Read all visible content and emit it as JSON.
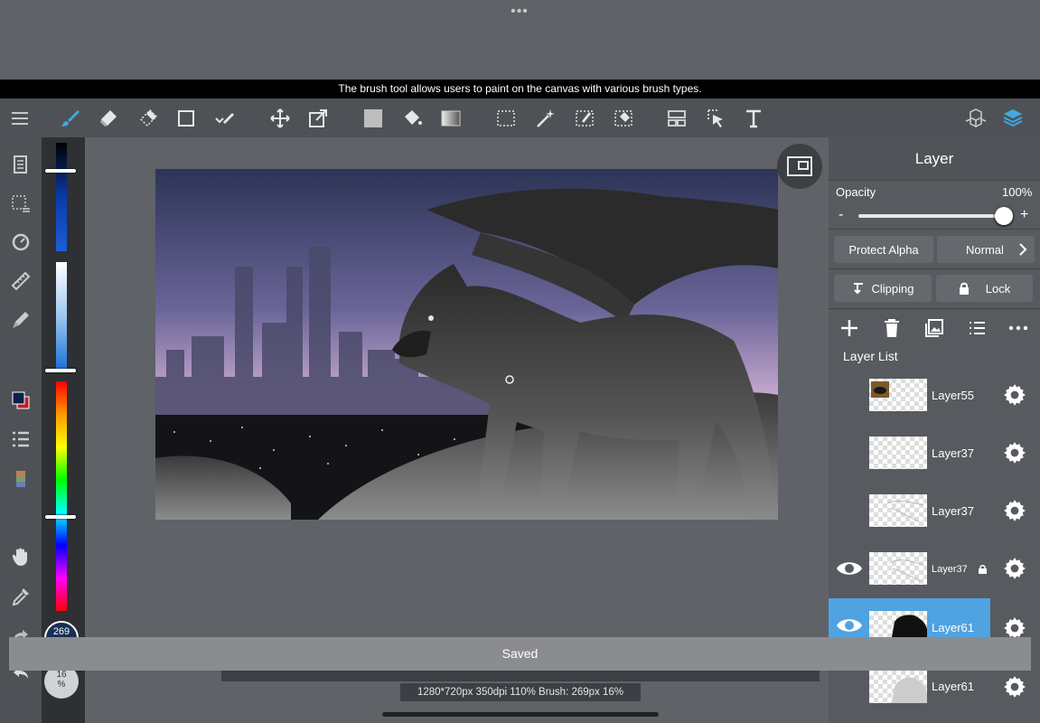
{
  "tooltip": "The brush tool allows users to paint on the canvas with various brush types.",
  "toolbar": {
    "tools": [
      "menu-icon",
      "brush-icon",
      "eraser-icon",
      "smudge-icon",
      "rectangle-icon",
      "select-check-icon",
      "move-icon",
      "transform-icon",
      "fill-color-icon",
      "bucket-icon",
      "gradient-icon",
      "select-rect-icon",
      "magic-wand-icon",
      "select-pen-icon",
      "select-eraser-icon",
      "layout-icon",
      "select-pointer-icon",
      "text-icon",
      "materials-icon",
      "layers-icon"
    ],
    "accent_color": "#3fa9e0"
  },
  "colors": {
    "primary": "#0b1f4a",
    "secondary": "#b8202a"
  },
  "layer_panel": {
    "title": "Layer",
    "opacity_label": "Opacity",
    "opacity_value": "100%",
    "opacity_fraction": 1.0,
    "minus_label": "-",
    "plus_label": "+",
    "protect_alpha_label": "Protect Alpha",
    "blend_mode": "Normal",
    "clipping_label": "Clipping",
    "lock_label": "Lock",
    "list_title": "Layer List",
    "layers": [
      {
        "name": "Layer55",
        "visible": false,
        "selected": false,
        "locked": false
      },
      {
        "name": "Layer37",
        "visible": false,
        "selected": false,
        "locked": false
      },
      {
        "name": "Layer37",
        "visible": false,
        "selected": false,
        "locked": false
      },
      {
        "name": "Layer37",
        "visible": true,
        "selected": false,
        "locked": true
      },
      {
        "name": "Layer61",
        "visible": true,
        "selected": true,
        "locked": false
      },
      {
        "name": "Layer61",
        "visible": false,
        "selected": false,
        "locked": false
      }
    ]
  },
  "brush_size": "269",
  "brush_opacity": "16\n%",
  "saved_message": "Saved",
  "status_text": "1280*720px 350dpi 110% Brush: 269px 16%"
}
